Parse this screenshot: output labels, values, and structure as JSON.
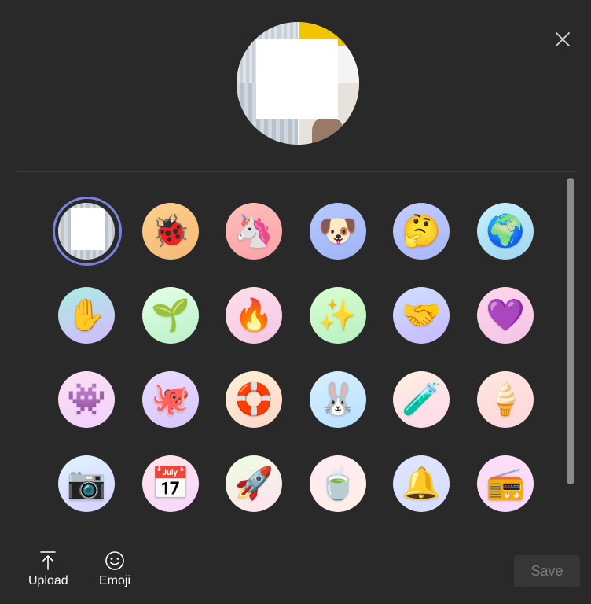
{
  "dialog": {
    "close_icon": "close-icon",
    "preview_alt": "Current profile picture"
  },
  "avatars": [
    {
      "kind": "photo",
      "icon": "person-photo",
      "selected": true,
      "bg": [
        "#e7e4df",
        "#cfd3d8"
      ]
    },
    {
      "kind": "emoji",
      "icon": "beetle-icon",
      "glyph": "🐞",
      "bg": [
        "#ffd08a",
        "#f3b978"
      ]
    },
    {
      "kind": "emoji",
      "icon": "unicorn-icon",
      "glyph": "🦄",
      "bg": [
        "#ffc1b8",
        "#f9a0a8"
      ]
    },
    {
      "kind": "emoji",
      "icon": "dog-face-icon",
      "glyph": "🐶",
      "bg": [
        "#b8c9ff",
        "#9fb3f6"
      ]
    },
    {
      "kind": "emoji",
      "icon": "thinking-face-icon",
      "glyph": "🤔",
      "bg": [
        "#c2cdff",
        "#a9b6f7"
      ]
    },
    {
      "kind": "emoji",
      "icon": "globe-icon",
      "glyph": "🌍",
      "bg": [
        "#c8f0ff",
        "#9ed6f0"
      ]
    },
    {
      "kind": "emoji",
      "icon": "reaching-hand-icon",
      "glyph": "✋",
      "bg": [
        "#a8f0e0",
        "#d6b6ff"
      ]
    },
    {
      "kind": "emoji",
      "icon": "seedling-hand-icon",
      "glyph": "🌱",
      "bg": [
        "#e6ffe6",
        "#b8f0c8"
      ]
    },
    {
      "kind": "emoji",
      "icon": "flame-hands-icon",
      "glyph": "🔥",
      "bg": [
        "#ffe0e8",
        "#f3c6e6"
      ]
    },
    {
      "kind": "emoji",
      "icon": "magic-wand-icon",
      "glyph": "✨",
      "bg": [
        "#d9ffd0",
        "#b8f0c0"
      ]
    },
    {
      "kind": "emoji",
      "icon": "handshake-icon",
      "glyph": "🤝",
      "bg": [
        "#cfe0ff",
        "#c6b8ff"
      ]
    },
    {
      "kind": "emoji",
      "icon": "heart-hands-icon",
      "glyph": "💜",
      "bg": [
        "#ffd6ec",
        "#f2c4e6"
      ]
    },
    {
      "kind": "emoji",
      "icon": "monster-icon",
      "glyph": "👾",
      "bg": [
        "#ffe0f0",
        "#f0d0ff"
      ]
    },
    {
      "kind": "emoji",
      "icon": "octopus-icon",
      "glyph": "🐙",
      "bg": [
        "#eadcff",
        "#d6c6ff"
      ]
    },
    {
      "kind": "emoji",
      "icon": "lifebuoy-icon",
      "glyph": "🛟",
      "bg": [
        "#fff0d8",
        "#ffd6c8"
      ]
    },
    {
      "kind": "emoji",
      "icon": "rabbit-hat-icon",
      "glyph": "🐰",
      "bg": [
        "#d8f0ff",
        "#b8e0ff"
      ]
    },
    {
      "kind": "emoji",
      "icon": "lab-flask-icon",
      "glyph": "🧪",
      "bg": [
        "#fff0e0",
        "#ffd8ec"
      ]
    },
    {
      "kind": "emoji",
      "icon": "ice-cream-icon",
      "glyph": "🍦",
      "bg": [
        "#ffe6e0",
        "#ffd6dc"
      ]
    },
    {
      "kind": "emoji",
      "icon": "camera-icon",
      "glyph": "📷",
      "bg": [
        "#e0f4ff",
        "#d6d0ff"
      ]
    },
    {
      "kind": "emoji",
      "icon": "calendar-icon",
      "glyph": "📅",
      "bg": [
        "#ffe6e6",
        "#f6d6ff"
      ]
    },
    {
      "kind": "emoji",
      "icon": "rocket-icon",
      "glyph": "🚀",
      "bg": [
        "#ecffe0",
        "#ffe0f0"
      ]
    },
    {
      "kind": "emoji",
      "icon": "teacup-icon",
      "glyph": "🍵",
      "bg": [
        "#ffeaf4",
        "#fff0e6"
      ]
    },
    {
      "kind": "emoji",
      "icon": "bell-icon",
      "glyph": "🔔",
      "bg": [
        "#e0e6ff",
        "#d6dcff"
      ]
    },
    {
      "kind": "emoji",
      "icon": "boombox-icon",
      "glyph": "📻",
      "bg": [
        "#ffe0f4",
        "#f6d6ff"
      ]
    }
  ],
  "footer": {
    "upload_label": "Upload",
    "upload_icon": "upload-icon",
    "emoji_label": "Emoji",
    "emoji_icon": "smiley-icon",
    "save_label": "Save"
  },
  "colors": {
    "background": "#292929",
    "selection_ring": "#7b7fdd",
    "save_disabled_bg": "#363636",
    "save_disabled_text": "#7a7a7a"
  }
}
